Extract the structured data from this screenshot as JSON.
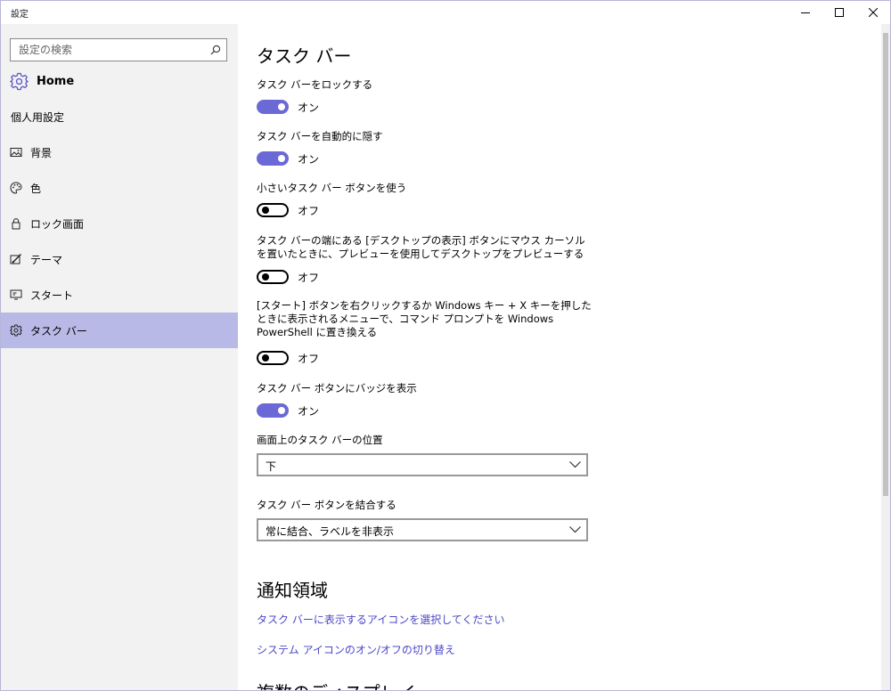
{
  "window": {
    "title": "設定"
  },
  "search": {
    "placeholder": "設定の検索"
  },
  "sidebar": {
    "home_label": "Home",
    "group_title": "個人用設定",
    "items": [
      {
        "label": "背景",
        "icon": "image-icon"
      },
      {
        "label": "色",
        "icon": "palette-icon"
      },
      {
        "label": "ロック画面",
        "icon": "lock-icon"
      },
      {
        "label": "テーマ",
        "icon": "theme-icon"
      },
      {
        "label": "スタート",
        "icon": "start-icon"
      },
      {
        "label": "タスク バー",
        "icon": "gear-icon",
        "selected": true
      }
    ]
  },
  "main": {
    "page_title": "タスク バー",
    "settings": [
      {
        "label": "タスク バーをロックする",
        "state": "オン"
      },
      {
        "label": "タスク バーを自動的に隠す",
        "state": "オン"
      },
      {
        "label": "小さいタスク バー ボタンを使う",
        "state": "オフ"
      },
      {
        "label": "タスク バーの端にある [デスクトップの表示] ボタンにマウス カーソルを置いたときに、プレビューを使用してデスクトップをプレビューする",
        "state": "オフ"
      },
      {
        "label": "[スタート] ボタンを右クリックするか Windows キー + X キーを押したときに表示されるメニューで、コマンド プロンプトを Windows PowerShell に置き換える",
        "state": "オフ"
      },
      {
        "label": "タスク バー ボタンにバッジを表示",
        "state": "オン"
      }
    ],
    "position": {
      "label": "画面上のタスク バーの位置",
      "value": "下"
    },
    "combine": {
      "label": "タスク バー ボタンを結合する",
      "value": "常に結合、ラベルを非表示"
    },
    "notification": {
      "title": "通知領域",
      "links": [
        "タスク バーに表示するアイコンを選択してください",
        "システム アイコンのオン/オフの切り替え"
      ]
    },
    "next_section_title": "複数のディスプレイ"
  },
  "colors": {
    "accent": "#6b69d6",
    "selected_bg": "#b9b9e8",
    "link": "#4b47c9"
  }
}
